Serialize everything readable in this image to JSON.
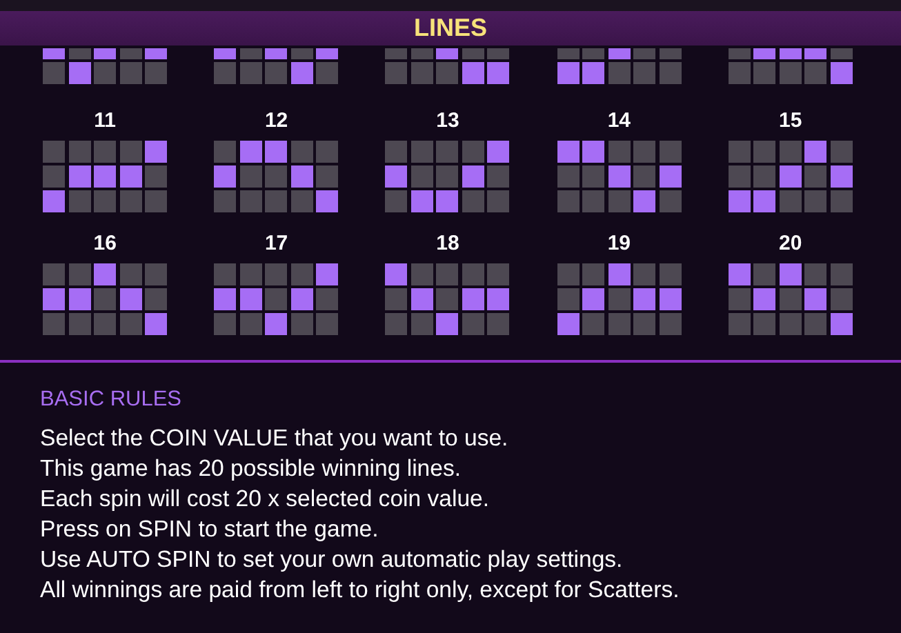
{
  "title": "LINES",
  "partial_lines": [
    {
      "rows": [
        [
          true,
          false,
          true,
          false,
          true
        ],
        [
          false,
          true,
          false,
          false,
          false
        ]
      ]
    },
    {
      "rows": [
        [
          true,
          false,
          true,
          false,
          true
        ],
        [
          false,
          false,
          false,
          true,
          false
        ]
      ]
    },
    {
      "rows": [
        [
          false,
          false,
          true,
          false,
          false
        ],
        [
          false,
          false,
          false,
          true,
          true
        ]
      ]
    },
    {
      "rows": [
        [
          false,
          false,
          true,
          false,
          false
        ],
        [
          true,
          true,
          false,
          false,
          false
        ]
      ]
    },
    {
      "rows": [
        [
          false,
          true,
          true,
          true,
          false
        ],
        [
          false,
          false,
          false,
          false,
          true
        ]
      ]
    }
  ],
  "lines": [
    {
      "number": "11",
      "rows": [
        [
          false,
          false,
          false,
          false,
          true
        ],
        [
          false,
          true,
          true,
          true,
          false
        ],
        [
          true,
          false,
          false,
          false,
          false
        ]
      ]
    },
    {
      "number": "12",
      "rows": [
        [
          false,
          true,
          true,
          false,
          false
        ],
        [
          true,
          false,
          false,
          true,
          false
        ],
        [
          false,
          false,
          false,
          false,
          true
        ]
      ]
    },
    {
      "number": "13",
      "rows": [
        [
          false,
          false,
          false,
          false,
          true
        ],
        [
          true,
          false,
          false,
          true,
          false
        ],
        [
          false,
          true,
          true,
          false,
          false
        ]
      ]
    },
    {
      "number": "14",
      "rows": [
        [
          true,
          true,
          false,
          false,
          false
        ],
        [
          false,
          false,
          true,
          false,
          true
        ],
        [
          false,
          false,
          false,
          true,
          false
        ]
      ]
    },
    {
      "number": "15",
      "rows": [
        [
          false,
          false,
          false,
          true,
          false
        ],
        [
          false,
          false,
          true,
          false,
          true
        ],
        [
          true,
          true,
          false,
          false,
          false
        ]
      ]
    },
    {
      "number": "16",
      "rows": [
        [
          false,
          false,
          true,
          false,
          false
        ],
        [
          true,
          true,
          false,
          true,
          false
        ],
        [
          false,
          false,
          false,
          false,
          true
        ]
      ]
    },
    {
      "number": "17",
      "rows": [
        [
          false,
          false,
          false,
          false,
          true
        ],
        [
          true,
          true,
          false,
          true,
          false
        ],
        [
          false,
          false,
          true,
          false,
          false
        ]
      ]
    },
    {
      "number": "18",
      "rows": [
        [
          true,
          false,
          false,
          false,
          false
        ],
        [
          false,
          true,
          false,
          true,
          true
        ],
        [
          false,
          false,
          true,
          false,
          false
        ]
      ]
    },
    {
      "number": "19",
      "rows": [
        [
          false,
          false,
          true,
          false,
          false
        ],
        [
          false,
          true,
          false,
          true,
          true
        ],
        [
          true,
          false,
          false,
          false,
          false
        ]
      ]
    },
    {
      "number": "20",
      "rows": [
        [
          true,
          false,
          true,
          false,
          false
        ],
        [
          false,
          true,
          false,
          true,
          false
        ],
        [
          false,
          false,
          false,
          false,
          true
        ]
      ]
    }
  ],
  "basic_rules": {
    "heading": "BASIC RULES",
    "lines": [
      "Select the COIN VALUE that you want to use.",
      "This game has 20 possible winning lines.",
      "Each spin will cost 20 x selected coin value.",
      "Press on SPIN to start the game.",
      "Use AUTO SPIN to set your own automatic play settings.",
      "All winnings are paid from left to right only, except for Scatters."
    ]
  }
}
